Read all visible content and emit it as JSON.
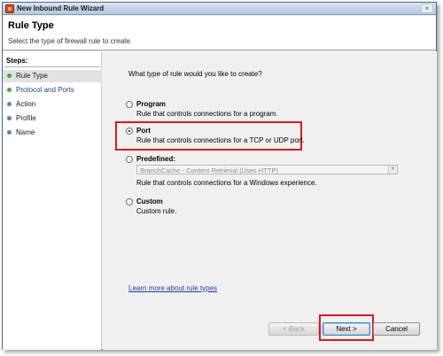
{
  "window": {
    "title": "New Inbound Rule Wizard",
    "close_label": "×"
  },
  "header": {
    "title": "Rule Type",
    "subtitle": "Select the type of firewall rule to create."
  },
  "steps": {
    "heading": "Steps:",
    "items": [
      {
        "label": "Rule Type",
        "status": "complete",
        "active": true
      },
      {
        "label": "Protocol and Ports",
        "status": "complete",
        "active": false
      },
      {
        "label": "Action",
        "status": "pending",
        "active": false
      },
      {
        "label": "Profile",
        "status": "pending",
        "active": false
      },
      {
        "label": "Name",
        "status": "pending",
        "active": false
      }
    ]
  },
  "content": {
    "question": "What type of rule would you like to create?",
    "options": {
      "program": {
        "label": "Program",
        "description": "Rule that controls connections for a program.",
        "selected": false
      },
      "port": {
        "label": "Port",
        "description": "Rule that controls connections for a TCP or UDP port.",
        "selected": true
      },
      "predefined": {
        "label": "Predefined:",
        "dropdown_value": "BranchCache - Content Retrieval (Uses HTTP)",
        "description": "Rule that controls connections for a Windows experience.",
        "selected": false
      },
      "custom": {
        "label": "Custom",
        "description": "Custom rule.",
        "selected": false
      }
    },
    "learn_more": "Learn more about rule types"
  },
  "buttons": {
    "back": "< Back",
    "next": "Next >",
    "cancel": "Cancel"
  },
  "colors": {
    "highlight": "#e3171b",
    "step_complete": "#3fae3c",
    "step_pending": "#5a7fbf",
    "link": "#1a3ea8"
  },
  "icons": {
    "title": "firewall-icon",
    "dropdown": "chevron-down-icon"
  }
}
